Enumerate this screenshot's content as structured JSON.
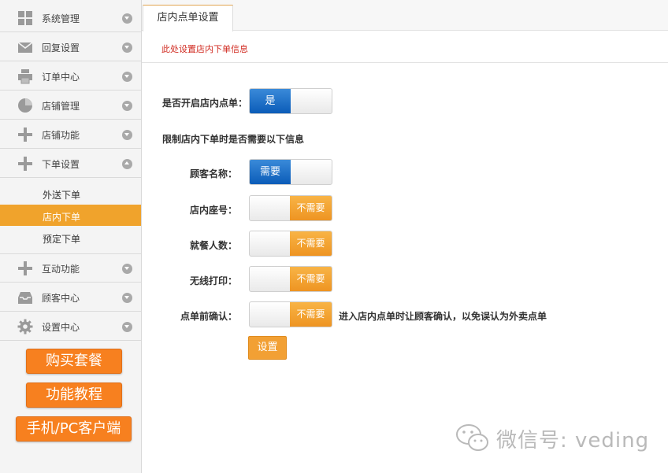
{
  "sidebar": {
    "items": [
      {
        "label": "系统管理",
        "icon": "grid-icon"
      },
      {
        "label": "回复设置",
        "icon": "envelope-icon"
      },
      {
        "label": "订单中心",
        "icon": "printer-icon"
      },
      {
        "label": "店铺管理",
        "icon": "pie-chart-icon"
      },
      {
        "label": "店铺功能",
        "icon": "plus-icon"
      },
      {
        "label": "下单设置",
        "icon": "plus-icon"
      },
      {
        "label": "互动功能",
        "icon": "plus-icon"
      },
      {
        "label": "顾客中心",
        "icon": "inbox-icon"
      },
      {
        "label": "设置中心",
        "icon": "gear-icon"
      }
    ],
    "subitems": [
      {
        "label": "外送下单"
      },
      {
        "label": "店内下单"
      },
      {
        "label": "预定下单"
      }
    ],
    "promo": {
      "buy": "购买套餐",
      "tutorial": "功能教程",
      "client": "手机/PC客户端"
    }
  },
  "tab": {
    "label": "店内点单设置"
  },
  "notice": "此处设置店内下单信息",
  "form": {
    "enable_label": "是否开启店内点单：",
    "enable_value": "是",
    "section_title": "限制店内下单时是否需要以下信息",
    "fields": [
      {
        "label": "顾客名称：",
        "value": "需要"
      },
      {
        "label": "店内座号：",
        "value": "不需要"
      },
      {
        "label": "就餐人数：",
        "value": "不需要"
      },
      {
        "label": "无线打印：",
        "value": "不需要"
      },
      {
        "label": "点单前确认：",
        "value": "不需要"
      }
    ],
    "confirm_hint": "进入店内点单时让顾客确认，以免误认为外卖点单",
    "submit": "设置"
  },
  "watermark": "微信号: veding",
  "colors": {
    "accent": "#f0a32c",
    "toggle_on": "#0b5cb8",
    "notice": "#d0291f"
  }
}
